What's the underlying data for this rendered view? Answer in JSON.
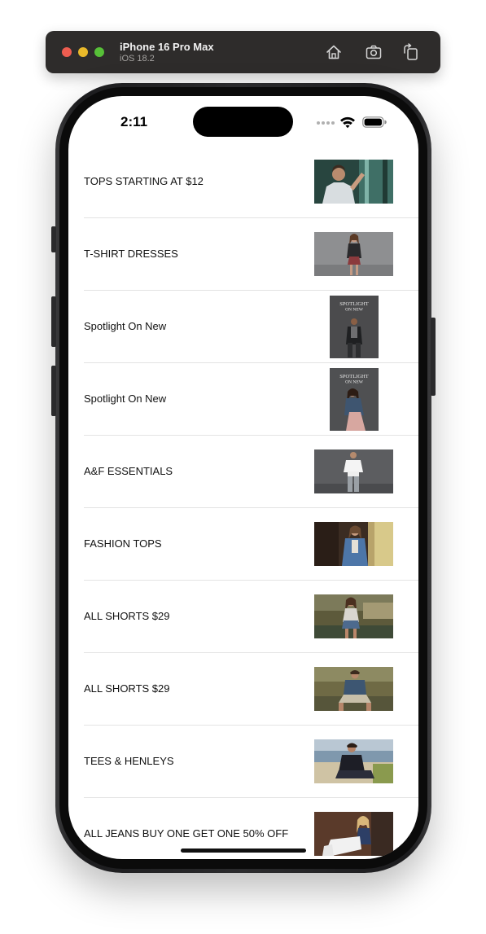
{
  "toolbar": {
    "device_name": "iPhone 16 Pro Max",
    "os_version": "iOS 18.2",
    "buttons": [
      {
        "name": "home-icon"
      },
      {
        "name": "screenshot-icon"
      },
      {
        "name": "rotate-icon"
      }
    ]
  },
  "status_bar": {
    "time": "2:11",
    "icons": [
      "cellular-signal-icon",
      "wifi-icon",
      "battery-icon"
    ]
  },
  "promotions": [
    {
      "label": "TOPS STARTING AT $12",
      "image": "tops-promo-image",
      "image_shape": "wide"
    },
    {
      "label": "T-SHIRT DRESSES",
      "image": "dresses-promo-image",
      "image_shape": "wide"
    },
    {
      "label": "Spotlight On New",
      "image": "spotlight-men-image",
      "image_shape": "tall",
      "image_text": "SPOTLIGHT ON NEW"
    },
    {
      "label": "Spotlight On New",
      "image": "spotlight-women-image",
      "image_shape": "tall",
      "image_text": "SPOTLIGHT ON NEW"
    },
    {
      "label": "A&F ESSENTIALS",
      "image": "essentials-promo-image",
      "image_shape": "wide"
    },
    {
      "label": "FASHION TOPS",
      "image": "fashion-tops-image",
      "image_shape": "wide"
    },
    {
      "label": "ALL SHORTS $29",
      "image": "shorts-women-image",
      "image_shape": "wide"
    },
    {
      "label": "ALL SHORTS $29",
      "image": "shorts-men-image",
      "image_shape": "wide"
    },
    {
      "label": "TEES & HENLEYS",
      "image": "tees-henleys-image",
      "image_shape": "wide"
    },
    {
      "label": "ALL JEANS BUY ONE GET ONE 50% OFF",
      "image": "jeans-promo-image",
      "image_shape": "wide"
    }
  ]
}
